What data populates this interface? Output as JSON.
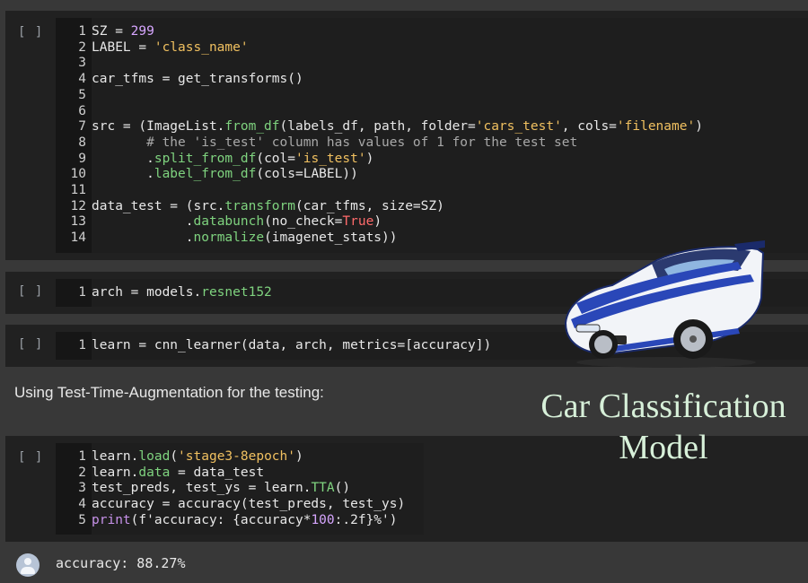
{
  "cells": [
    {
      "run_label": "[ ]",
      "lines": [
        {
          "no": "1",
          "html": "SZ = <span class=\"n\">299</span>"
        },
        {
          "no": "2",
          "html": "LABEL = <span class=\"s\">'class_name'</span>"
        },
        {
          "no": "3",
          "html": ""
        },
        {
          "no": "4",
          "html": "car_tfms = get_transforms()"
        },
        {
          "no": "5",
          "html": ""
        },
        {
          "no": "6",
          "html": ""
        },
        {
          "no": "7",
          "html": "src = (ImageList.<span class=\"f\">from_df</span>(labels_df, path, folder=<span class=\"s\">'cars_test'</span>, cols=<span class=\"s\">'filename'</span>)"
        },
        {
          "no": "8",
          "html": "       <span class=\"c\"># the 'is_test' column has values of 1 for the test set</span>"
        },
        {
          "no": "9",
          "html": "       .<span class=\"f\">split_from_df</span>(col=<span class=\"s\">'is_test'</span>)"
        },
        {
          "no": "10",
          "html": "       .<span class=\"f\">label_from_df</span>(cols=LABEL))"
        },
        {
          "no": "11",
          "html": ""
        },
        {
          "no": "12",
          "html": "data_test = (src.<span class=\"f\">transform</span>(car_tfms, size=SZ)"
        },
        {
          "no": "13",
          "html": "            .<span class=\"f\">databunch</span>(no_check=<span class=\"k\">True</span>)"
        },
        {
          "no": "14",
          "html": "            .<span class=\"f\">normalize</span>(imagenet_stats))"
        }
      ]
    },
    {
      "run_label": "[ ]",
      "lines": [
        {
          "no": "1",
          "html": "arch = models.<span class=\"f\">resnet152</span>"
        }
      ]
    },
    {
      "run_label": "[ ]",
      "lines": [
        {
          "no": "1",
          "html": "learn = cnn_learner(data, arch, metrics=[accuracy])"
        }
      ]
    },
    {
      "run_label": "[ ]",
      "lines": [
        {
          "no": "1",
          "html": "learn.<span class=\"f\">load</span>(<span class=\"s\">'stage3-8epoch'</span>)"
        },
        {
          "no": "2",
          "html": "learn.<span class=\"f\">data</span> = data_test"
        },
        {
          "no": "3",
          "html": "test_preds, test_ys = learn.<span class=\"f\">TTA</span>()"
        },
        {
          "no": "4",
          "html": "accuracy = accuracy(test_preds, test_ys)"
        },
        {
          "no": "5",
          "html": "<span class=\"p\">print</span>(f'accuracy: {accuracy*<span class=\"n\">100</span>:.2f}%')"
        }
      ]
    }
  ],
  "text_cell": "Using Test-Time-Augmentation for the testing:",
  "output": {
    "avatar_icon": "user-avatar-icon",
    "text": "accuracy: 88.27%"
  },
  "overlay": {
    "title_line1": "Car Classification",
    "title_line2": "Model",
    "image_icon": "sports-car-illustration"
  },
  "colors": {
    "background": "#383838",
    "cell": "#212121",
    "string": "#f0c060",
    "number": "#d7a6ff",
    "function": "#7fd37f",
    "keyword": "#ff6b6b"
  }
}
